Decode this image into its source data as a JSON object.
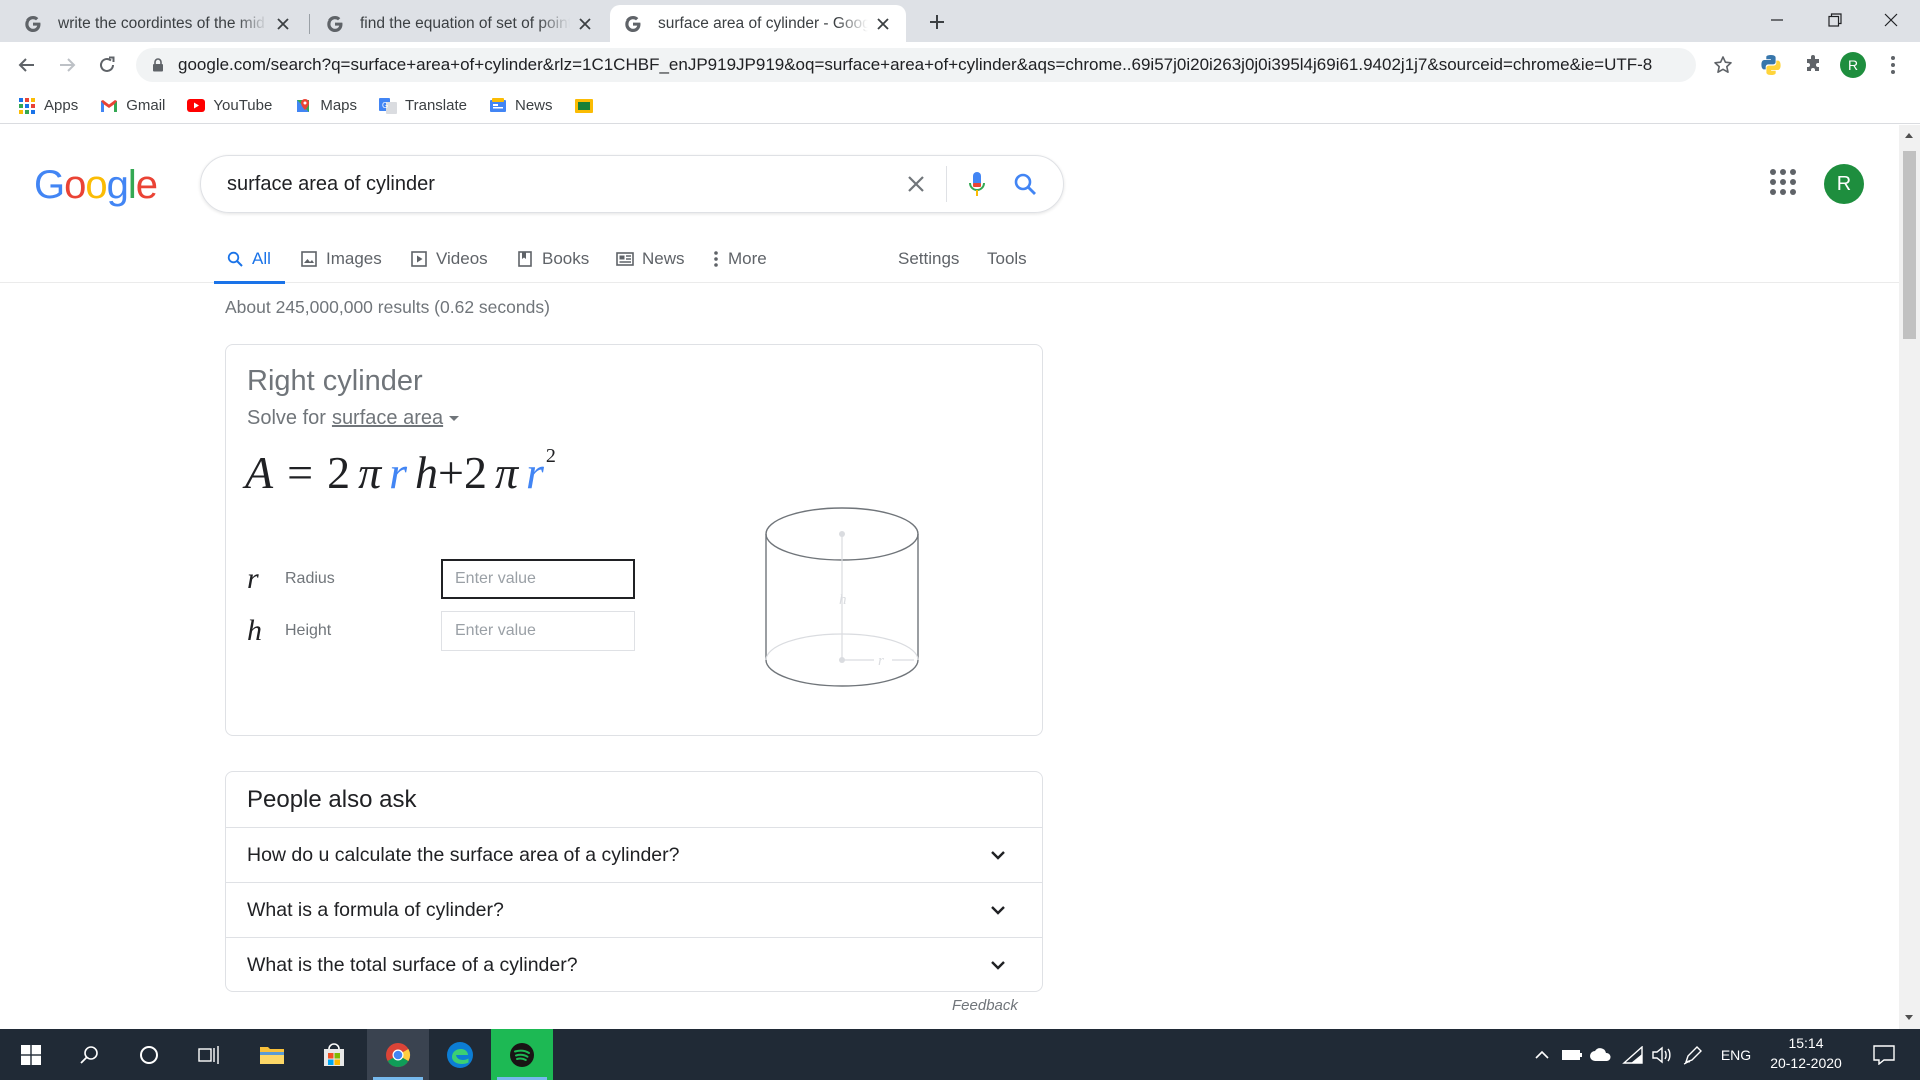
{
  "browser": {
    "tabs": [
      {
        "title": "write the coordintes of the mid p",
        "active": false
      },
      {
        "title": "find the equation of set of points",
        "active": false
      },
      {
        "title": "surface area of cylinder - Google",
        "active": true
      }
    ],
    "url": "google.com/search?q=surface+area+of+cylinder&rlz=1C1CHBF_enJP919JP919&oq=surface+area+of+cylinder&aqs=chrome..69i57j0i20i263j0j0i395l4j69i61.9402j1j7&sourceid=chrome&ie=UTF-8",
    "profile_initial": "R",
    "bookmarks": [
      {
        "label": "Apps",
        "icon": "apps-grid-icon"
      },
      {
        "label": "Gmail",
        "icon": "gmail-icon"
      },
      {
        "label": "YouTube",
        "icon": "youtube-icon"
      },
      {
        "label": "Maps",
        "icon": "maps-icon"
      },
      {
        "label": "Translate",
        "icon": "translate-icon"
      },
      {
        "label": "News",
        "icon": "news-icon"
      },
      {
        "label": "",
        "icon": "bookmark-folder-icon"
      }
    ]
  },
  "google": {
    "logo": "Google",
    "query": "surface area of cylinder",
    "avatar_initial": "R",
    "tabs": [
      {
        "label": "All",
        "icon": "search-icon",
        "active": true
      },
      {
        "label": "Images",
        "icon": "image-icon"
      },
      {
        "label": "Videos",
        "icon": "play-icon"
      },
      {
        "label": "Books",
        "icon": "book-icon"
      },
      {
        "label": "News",
        "icon": "newspaper-icon"
      },
      {
        "label": "More",
        "icon": "more-vertical-icon"
      }
    ],
    "settings_label": "Settings",
    "tools_label": "Tools",
    "result_stats": "About 245,000,000 results (0.62 seconds)"
  },
  "calculator": {
    "title": "Right cylinder",
    "solve_for_prefix": "Solve for",
    "solve_for_value": "surface area",
    "formula": {
      "lhs": "A",
      "equals": "=",
      "coef1": "2",
      "pi": "π",
      "r": "r",
      "h": "h",
      "plus": "+",
      "coef2": "2",
      "exp": "2"
    },
    "variables": [
      {
        "symbol": "r",
        "label": "Radius",
        "placeholder": "Enter value",
        "focused": true
      },
      {
        "symbol": "h",
        "label": "Height",
        "placeholder": "Enter value",
        "focused": false
      }
    ],
    "diagram_labels": {
      "height": "h",
      "radius": "r"
    }
  },
  "people_also_ask": {
    "title": "People also ask",
    "questions": [
      "How do u calculate the surface area of a cylinder?",
      "What is a formula of cylinder?",
      "What is the total surface of a cylinder?"
    ],
    "feedback": "Feedback"
  },
  "taskbar": {
    "language": "ENG",
    "time": "15:14",
    "date": "20-12-2020"
  },
  "colors": {
    "accent": "#1a73e8",
    "formula_variable": "#4285f4",
    "avatar": "#1e8e3e",
    "taskbar": "#202a36"
  }
}
